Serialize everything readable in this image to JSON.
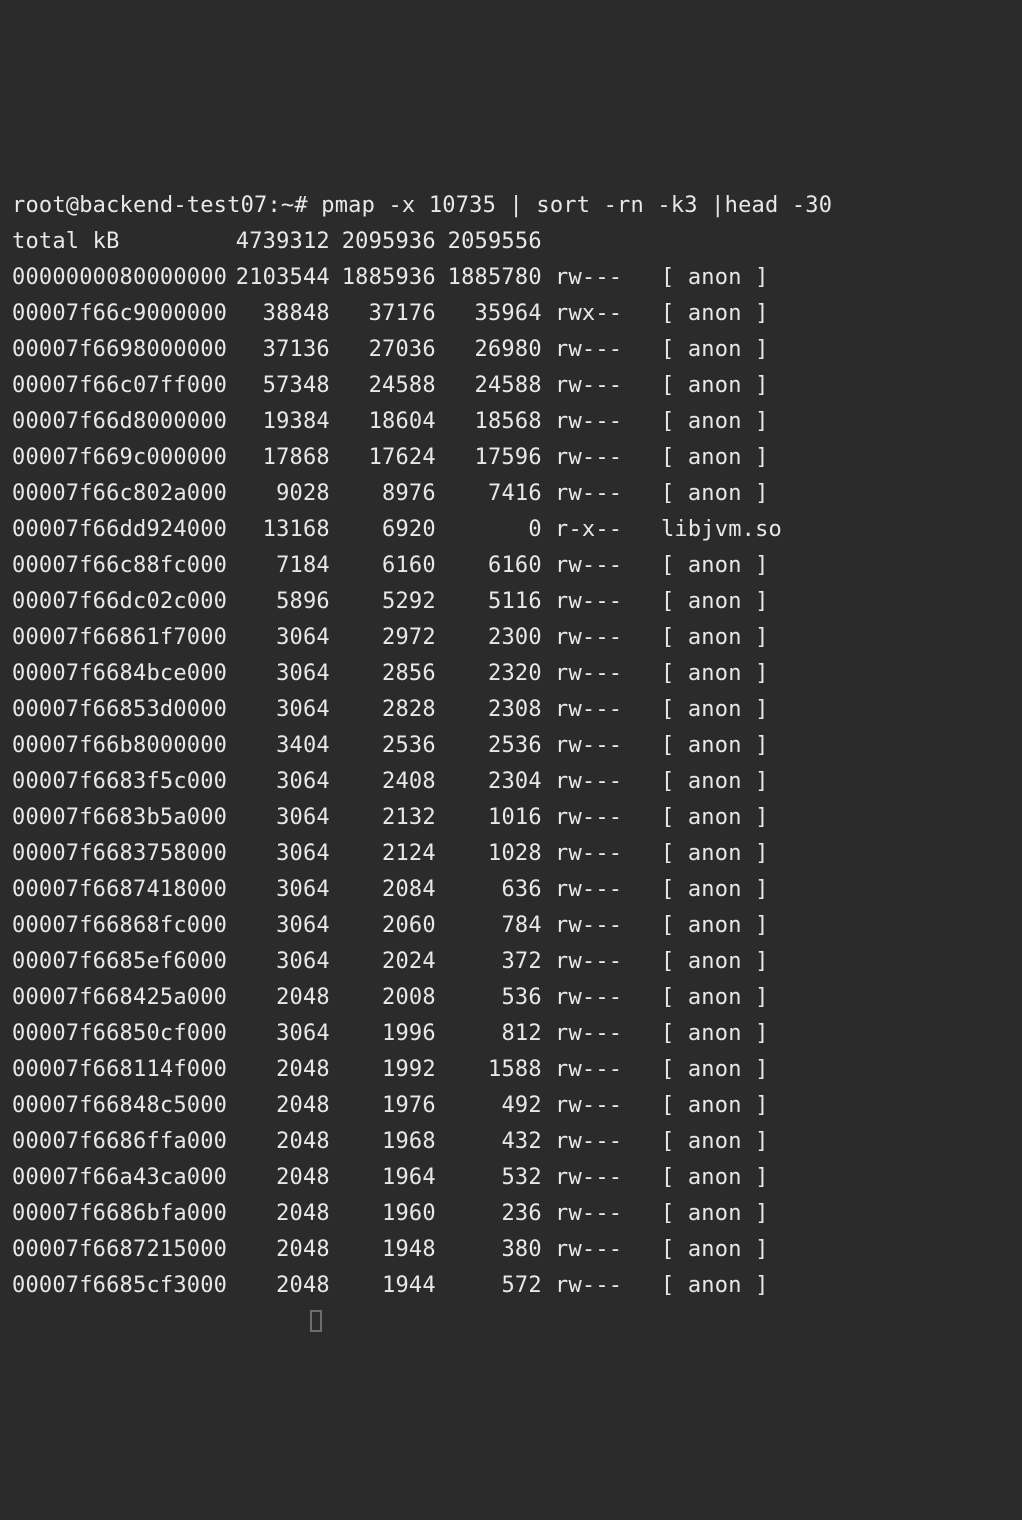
{
  "prompt": {
    "user": "root@backend-test07",
    "path": "~",
    "symbol": "#"
  },
  "command": "pmap -x 10735 | sort -rn -k3 |head -30",
  "total_label": "total kB",
  "total": {
    "kb": "4739312",
    "rss": "2095936",
    "dirty": "2059556"
  },
  "rows": [
    {
      "addr": "0000000080000000",
      "kb": "2103544",
      "rss": "1885936",
      "dirty": "1885780",
      "mode": "rw---",
      "map": "[ anon ]"
    },
    {
      "addr": "00007f66c9000000",
      "kb": "38848",
      "rss": "37176",
      "dirty": "35964",
      "mode": "rwx--",
      "map": "[ anon ]"
    },
    {
      "addr": "00007f6698000000",
      "kb": "37136",
      "rss": "27036",
      "dirty": "26980",
      "mode": "rw---",
      "map": "[ anon ]"
    },
    {
      "addr": "00007f66c07ff000",
      "kb": "57348",
      "rss": "24588",
      "dirty": "24588",
      "mode": "rw---",
      "map": "[ anon ]"
    },
    {
      "addr": "00007f66d8000000",
      "kb": "19384",
      "rss": "18604",
      "dirty": "18568",
      "mode": "rw---",
      "map": "[ anon ]"
    },
    {
      "addr": "00007f669c000000",
      "kb": "17868",
      "rss": "17624",
      "dirty": "17596",
      "mode": "rw---",
      "map": "[ anon ]"
    },
    {
      "addr": "00007f66c802a000",
      "kb": "9028",
      "rss": "8976",
      "dirty": "7416",
      "mode": "rw---",
      "map": "[ anon ]"
    },
    {
      "addr": "00007f66dd924000",
      "kb": "13168",
      "rss": "6920",
      "dirty": "0",
      "mode": "r-x--",
      "map": "libjvm.so"
    },
    {
      "addr": "00007f66c88fc000",
      "kb": "7184",
      "rss": "6160",
      "dirty": "6160",
      "mode": "rw---",
      "map": "[ anon ]"
    },
    {
      "addr": "00007f66dc02c000",
      "kb": "5896",
      "rss": "5292",
      "dirty": "5116",
      "mode": "rw---",
      "map": "[ anon ]"
    },
    {
      "addr": "00007f66861f7000",
      "kb": "3064",
      "rss": "2972",
      "dirty": "2300",
      "mode": "rw---",
      "map": "[ anon ]"
    },
    {
      "addr": "00007f6684bce000",
      "kb": "3064",
      "rss": "2856",
      "dirty": "2320",
      "mode": "rw---",
      "map": "[ anon ]"
    },
    {
      "addr": "00007f66853d0000",
      "kb": "3064",
      "rss": "2828",
      "dirty": "2308",
      "mode": "rw---",
      "map": "[ anon ]"
    },
    {
      "addr": "00007f66b8000000",
      "kb": "3404",
      "rss": "2536",
      "dirty": "2536",
      "mode": "rw---",
      "map": "[ anon ]"
    },
    {
      "addr": "00007f6683f5c000",
      "kb": "3064",
      "rss": "2408",
      "dirty": "2304",
      "mode": "rw---",
      "map": "[ anon ]"
    },
    {
      "addr": "00007f6683b5a000",
      "kb": "3064",
      "rss": "2132",
      "dirty": "1016",
      "mode": "rw---",
      "map": "[ anon ]"
    },
    {
      "addr": "00007f6683758000",
      "kb": "3064",
      "rss": "2124",
      "dirty": "1028",
      "mode": "rw---",
      "map": "[ anon ]"
    },
    {
      "addr": "00007f6687418000",
      "kb": "3064",
      "rss": "2084",
      "dirty": "636",
      "mode": "rw---",
      "map": "[ anon ]"
    },
    {
      "addr": "00007f66868fc000",
      "kb": "3064",
      "rss": "2060",
      "dirty": "784",
      "mode": "rw---",
      "map": "[ anon ]"
    },
    {
      "addr": "00007f6685ef6000",
      "kb": "3064",
      "rss": "2024",
      "dirty": "372",
      "mode": "rw---",
      "map": "[ anon ]"
    },
    {
      "addr": "00007f668425a000",
      "kb": "2048",
      "rss": "2008",
      "dirty": "536",
      "mode": "rw---",
      "map": "[ anon ]"
    },
    {
      "addr": "00007f66850cf000",
      "kb": "3064",
      "rss": "1996",
      "dirty": "812",
      "mode": "rw---",
      "map": "[ anon ]"
    },
    {
      "addr": "00007f668114f000",
      "kb": "2048",
      "rss": "1992",
      "dirty": "1588",
      "mode": "rw---",
      "map": "[ anon ]"
    },
    {
      "addr": "00007f66848c5000",
      "kb": "2048",
      "rss": "1976",
      "dirty": "492",
      "mode": "rw---",
      "map": "[ anon ]"
    },
    {
      "addr": "00007f6686ffa000",
      "kb": "2048",
      "rss": "1968",
      "dirty": "432",
      "mode": "rw---",
      "map": "[ anon ]"
    },
    {
      "addr": "00007f66a43ca000",
      "kb": "2048",
      "rss": "1964",
      "dirty": "532",
      "mode": "rw---",
      "map": "[ anon ]"
    },
    {
      "addr": "00007f6686bfa000",
      "kb": "2048",
      "rss": "1960",
      "dirty": "236",
      "mode": "rw---",
      "map": "[ anon ]"
    },
    {
      "addr": "00007f6687215000",
      "kb": "2048",
      "rss": "1948",
      "dirty": "380",
      "mode": "rw---",
      "map": "[ anon ]"
    },
    {
      "addr": "00007f6685cf3000",
      "kb": "2048",
      "rss": "1944",
      "dirty": "572",
      "mode": "rw---",
      "map": "[ anon ]"
    }
  ]
}
